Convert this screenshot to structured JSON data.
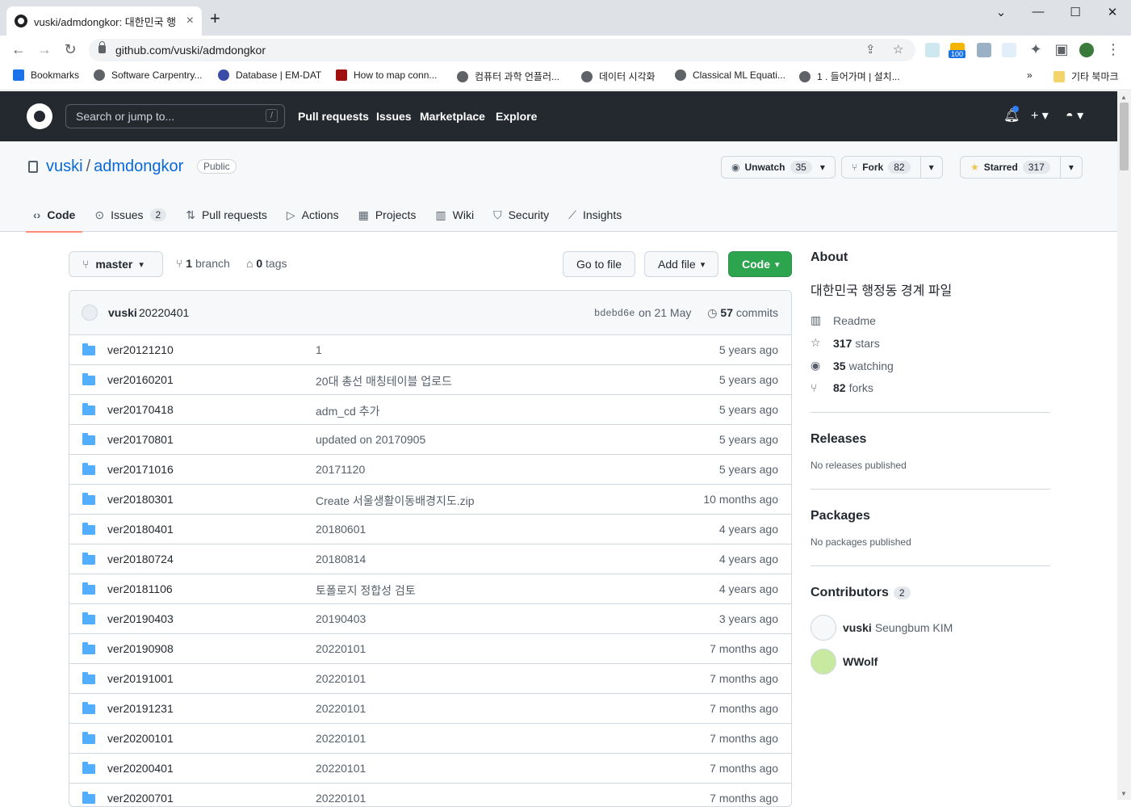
{
  "browser": {
    "tab_title": "vuski/admdongkor: 대한민국 행",
    "tab_close": "×",
    "new_tab": "+",
    "url": "github.com/vuski/admdongkor",
    "ext_badge": "100",
    "window_controls": [
      "⌄",
      "—",
      "☐",
      "✕"
    ],
    "bookmarks": [
      {
        "label": "Bookmarks",
        "icon": "star-icon"
      },
      {
        "label": "Software Carpentry...",
        "icon": "globe-icon"
      },
      {
        "label": "Database | EM-DAT",
        "icon": "emdat-icon"
      },
      {
        "label": "How to map conn...",
        "icon": "f-icon"
      },
      {
        "label": "컴퓨터 과학 언플러...",
        "icon": "globe-icon"
      },
      {
        "label": "데이터 시각화",
        "icon": "globe-icon"
      },
      {
        "label": "Classical ML Equati...",
        "icon": "globe-icon"
      },
      {
        "label": "1 . 들어가며 | 설치...",
        "icon": "globe-icon"
      }
    ],
    "bookmarks_more": "»",
    "other_bookmarks": "기타 북마크"
  },
  "gh": {
    "search_placeholder": "Search or jump to...",
    "slash": "/",
    "nav": [
      "Pull requests",
      "Issues",
      "Marketplace",
      "Explore"
    ]
  },
  "repo": {
    "owner": "vuski",
    "sep": "/",
    "name": "admdongkor",
    "visibility": "Public",
    "unwatch_label": "Unwatch",
    "unwatch_count": "35",
    "fork_label": "Fork",
    "fork_count": "82",
    "star_label": "Starred",
    "star_count": "317",
    "tabs": [
      {
        "label": "Code",
        "icon": "‹›"
      },
      {
        "label": "Issues",
        "icon": "⊙",
        "counter": "2"
      },
      {
        "label": "Pull requests",
        "icon": "⇅"
      },
      {
        "label": "Actions",
        "icon": "▷"
      },
      {
        "label": "Projects",
        "icon": "▦"
      },
      {
        "label": "Wiki",
        "icon": "▥"
      },
      {
        "label": "Security",
        "icon": "⛉"
      },
      {
        "label": "Insights",
        "icon": "⟋"
      }
    ]
  },
  "filenav": {
    "branch": "master",
    "branch_count": "1",
    "branch_label": "branch",
    "tag_count": "0",
    "tag_label": "tags",
    "go_to_file": "Go to file",
    "add_file": "Add file",
    "code": "Code"
  },
  "commit": {
    "author": "vuski",
    "message": "20220401",
    "sha": "bdebd6e",
    "when": "on 21 May",
    "count": "57",
    "count_label": "commits"
  },
  "files": [
    {
      "name": "ver20121210",
      "msg": "1",
      "age": "5 years ago"
    },
    {
      "name": "ver20160201",
      "msg": "20대 총선 매칭테이블 업로드",
      "age": "5 years ago"
    },
    {
      "name": "ver20170418",
      "msg": "adm_cd 추가",
      "age": "5 years ago"
    },
    {
      "name": "ver20170801",
      "msg": "updated on 20170905",
      "age": "5 years ago"
    },
    {
      "name": "ver20171016",
      "msg": "20171120",
      "age": "5 years ago"
    },
    {
      "name": "ver20180301",
      "msg": "Create 서울생활이동배경지도.zip",
      "age": "10 months ago"
    },
    {
      "name": "ver20180401",
      "msg": "20180601",
      "age": "4 years ago"
    },
    {
      "name": "ver20180724",
      "msg": "20180814",
      "age": "4 years ago"
    },
    {
      "name": "ver20181106",
      "msg": "토폴로지 정합성 검토",
      "age": "4 years ago"
    },
    {
      "name": "ver20190403",
      "msg": "20190403",
      "age": "3 years ago"
    },
    {
      "name": "ver20190908",
      "msg": "20220101",
      "age": "7 months ago"
    },
    {
      "name": "ver20191001",
      "msg": "20220101",
      "age": "7 months ago"
    },
    {
      "name": "ver20191231",
      "msg": "20220101",
      "age": "7 months ago"
    },
    {
      "name": "ver20200101",
      "msg": "20220101",
      "age": "7 months ago"
    },
    {
      "name": "ver20200401",
      "msg": "20220101",
      "age": "7 months ago"
    },
    {
      "name": "ver20200701",
      "msg": "20220101",
      "age": "7 months ago"
    }
  ],
  "about": {
    "title": "About",
    "description": "대한민국 행정동 경계 파일",
    "readme": "Readme",
    "stars_count": "317",
    "stars_label": "stars",
    "watching_count": "35",
    "watching_label": "watching",
    "forks_count": "82",
    "forks_label": "forks"
  },
  "releases": {
    "title": "Releases",
    "text": "No releases published"
  },
  "packages": {
    "title": "Packages",
    "text": "No packages published"
  },
  "contributors": {
    "title": "Contributors",
    "count": "2",
    "list": [
      {
        "login": "vuski",
        "name": "Seungbum KIM"
      },
      {
        "login": "WWolf",
        "name": ""
      }
    ]
  }
}
